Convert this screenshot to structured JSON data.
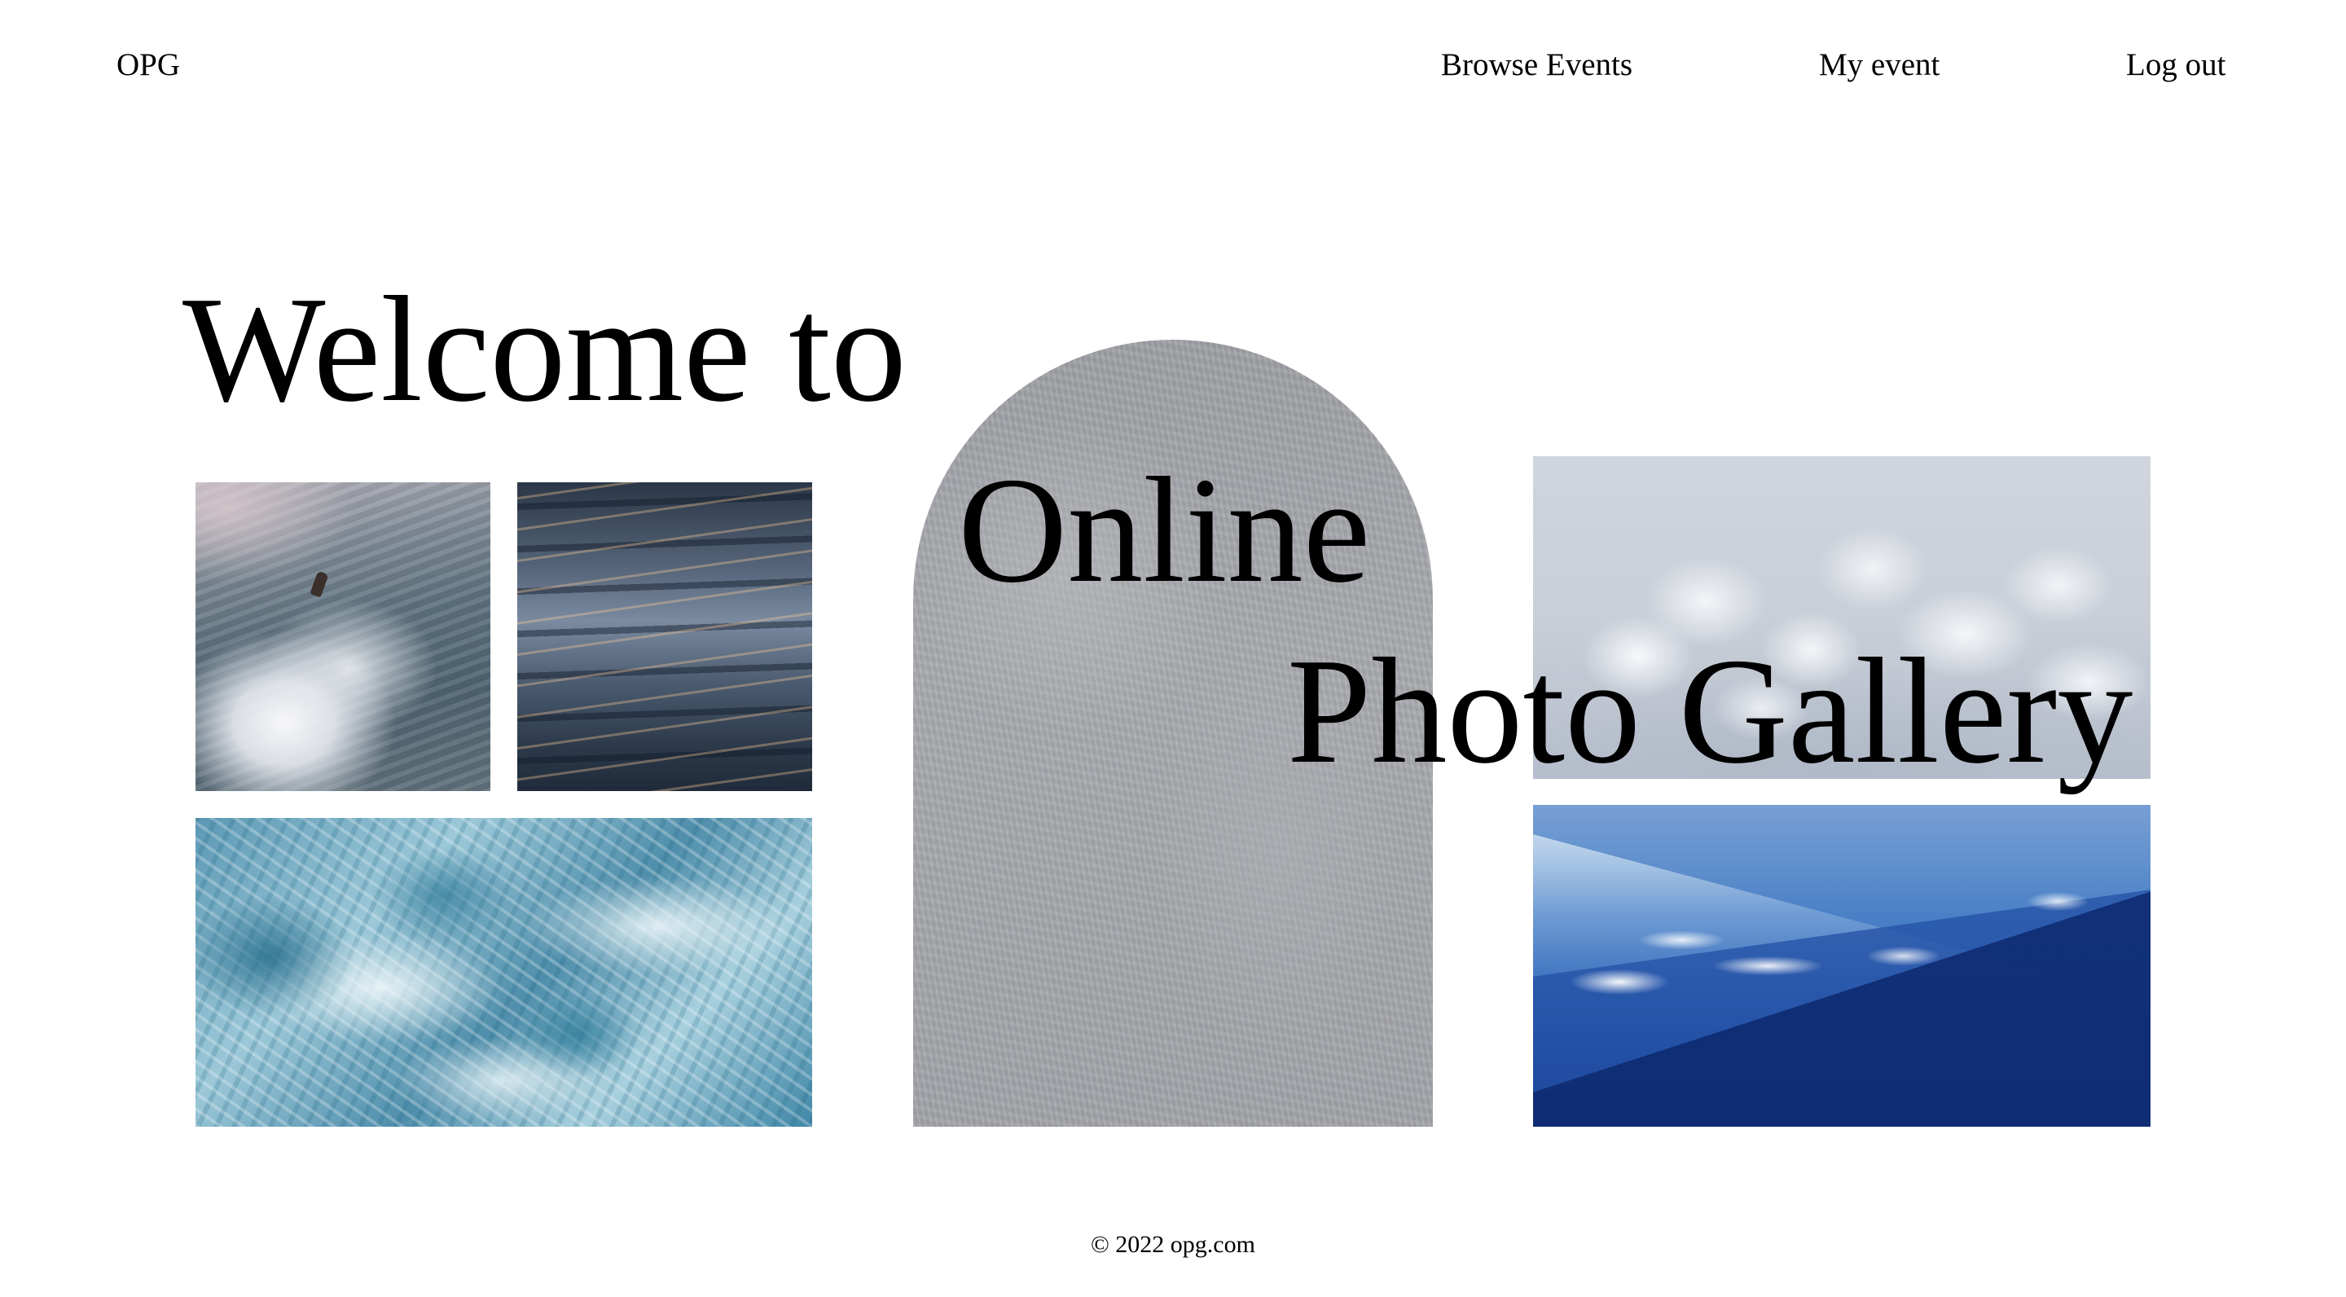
{
  "nav": {
    "logo": "OPG",
    "links": [
      {
        "label": "Browse Events"
      },
      {
        "label": "My event"
      },
      {
        "label": "Log out"
      }
    ]
  },
  "hero": {
    "lines": [
      "Welcome to",
      "Online",
      "Photo Gallery"
    ]
  },
  "gallery": {
    "images": [
      "surfer-wave-photo",
      "water-ripples-photo",
      "ocean-foam-photo",
      "concrete-arch-photo",
      "clouds-photo",
      "blue-mountains-photo"
    ]
  },
  "footer": {
    "copyright": "© 2022 opg.com"
  }
}
